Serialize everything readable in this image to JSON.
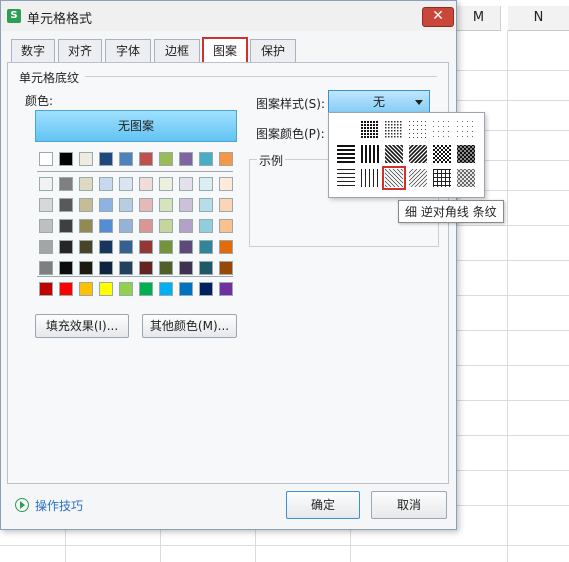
{
  "sheet": {
    "columns": [
      "M",
      "N"
    ]
  },
  "dialog": {
    "title": "单元格格式",
    "close_label": "✕",
    "tabs": [
      "数字",
      "对齐",
      "字体",
      "边框",
      "图案",
      "保护"
    ],
    "active_tab": "图案",
    "section_title": "单元格底纹",
    "color_label": "颜色:",
    "no_pattern_label": "无图案",
    "fill_effects_label": "填充效果(I)...",
    "more_colors_label": "其他颜色(M)...",
    "pattern_style_label": "图案样式(S):",
    "pattern_style_value": "无",
    "pattern_color_label": "图案颜色(P):",
    "sample_label": "示例",
    "tooltip": "细 逆对角线 条纹",
    "tips_link": "操作技巧",
    "ok_label": "确定",
    "cancel_label": "取消"
  },
  "palette": {
    "row1": [
      "#ffffff",
      "#000000",
      "#eeece1",
      "#1f497d",
      "#4f81bd",
      "#c0504d",
      "#9bbb59",
      "#8064a2",
      "#4bacc6",
      "#f79646"
    ],
    "tints": [
      [
        "#f2f2f2",
        "#7f7f7f",
        "#ddd9c3",
        "#c6d9f0",
        "#dbe5f1",
        "#f2dcdb",
        "#ebf1dd",
        "#e5e0ec",
        "#dbeef3",
        "#fdeada"
      ],
      [
        "#d8d8d8",
        "#595959",
        "#c4bd97",
        "#8db3e2",
        "#b8cce4",
        "#e5b9b7",
        "#d7e3bc",
        "#ccc1d9",
        "#b7dde8",
        "#fbd5b5"
      ],
      [
        "#bfbfbf",
        "#3f3f3f",
        "#938953",
        "#548dd4",
        "#95b3d7",
        "#d99694",
        "#c3d69b",
        "#b2a2c7",
        "#92cddc",
        "#fac08f"
      ],
      [
        "#a5a5a5",
        "#262626",
        "#494429",
        "#17365d",
        "#366092",
        "#953734",
        "#76923c",
        "#5f497a",
        "#31859b",
        "#e36c09"
      ],
      [
        "#7f7f7f",
        "#0c0c0c",
        "#1d1b10",
        "#0f243e",
        "#244061",
        "#632423",
        "#4f6128",
        "#3f3151",
        "#205867",
        "#974806"
      ]
    ],
    "standard": [
      "#c00000",
      "#ff0000",
      "#ffc000",
      "#ffff00",
      "#92d050",
      "#00b050",
      "#00b0f0",
      "#0070c0",
      "#002060",
      "#7030a0"
    ]
  },
  "patterns": {
    "rows": [
      [
        "none",
        "solid-dark-dots",
        "dense-dots",
        "medium-dots",
        "light-dots",
        "sparse-dots"
      ],
      [
        "thick-horizontal",
        "thick-vertical",
        "thick-reverse-diagonal",
        "thick-diagonal",
        "thick-crosshatch",
        "thick-diagonal-crosshatch"
      ],
      [
        "thin-horizontal",
        "thin-vertical",
        "thin-reverse-diagonal",
        "thin-diagonal",
        "thin-crosshatch",
        "thin-diagonal-crosshatch"
      ]
    ],
    "selected": "thin-reverse-diagonal"
  }
}
